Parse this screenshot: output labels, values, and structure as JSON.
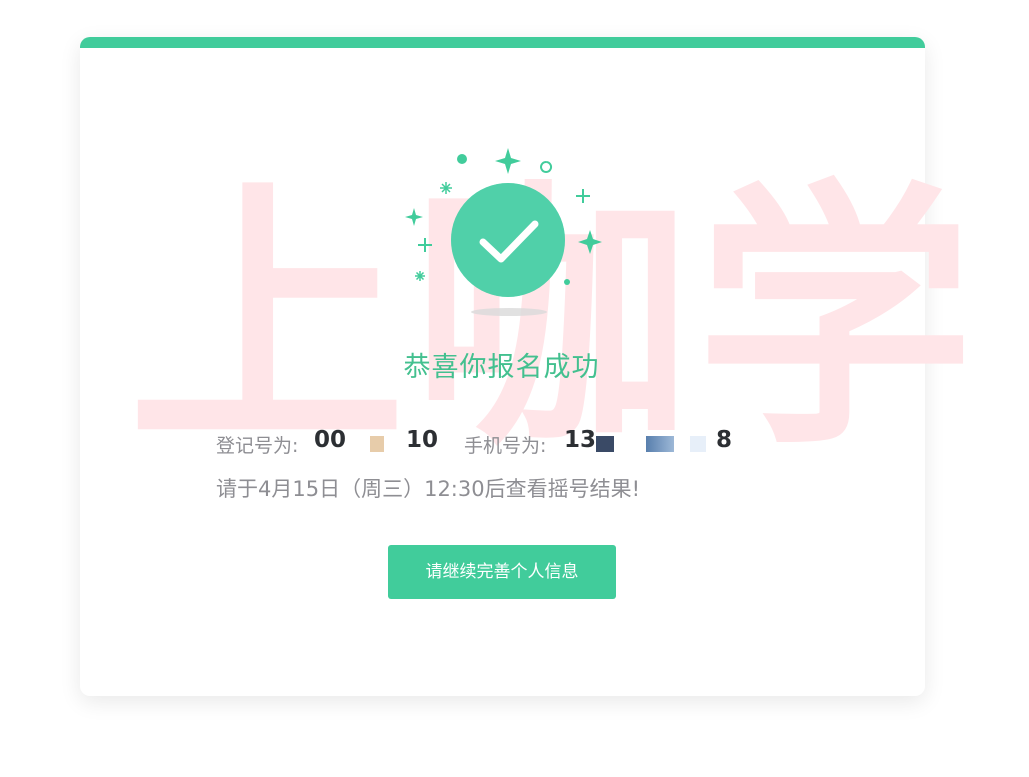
{
  "watermark": {
    "text": "上咖学"
  },
  "success": {
    "title": "恭喜你报名成功",
    "icon": "check-circle-icon"
  },
  "registration": {
    "reg_label": "登记号为:",
    "reg_number_prefix": "00",
    "reg_number_suffix": "10",
    "phone_label": "手机号为:",
    "phone_prefix": "13",
    "phone_suffix": "8"
  },
  "notice": {
    "text": "请于4月15日（周三）12:30后查看摇号结果!"
  },
  "actions": {
    "continue_label": "请继续完善个人信息"
  },
  "colors": {
    "accent": "#41cc9b",
    "title_green": "#43c08f",
    "label_gray": "#8e8e93",
    "value_dark": "#2c2f33",
    "watermark_pink": "#ffe5e8"
  }
}
